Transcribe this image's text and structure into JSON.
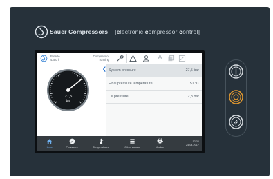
{
  "brand": {
    "name": "Sauer Compressors",
    "tagline_open": "[",
    "tagline_parts": [
      {
        "b": "e",
        "t": "lectronic "
      },
      {
        "b": "c",
        "t": "ompressor "
      },
      {
        "b": "c",
        "t": "ontrol"
      }
    ],
    "tagline_close": "]",
    "tagline": "[electronic compressor control]"
  },
  "status_bar": {
    "ship_line1": "Breeze",
    "ship_line2": "4350 h",
    "state_line1": "Compressor",
    "state_line2": "running",
    "icons": [
      "wrench-icon",
      "warning-icon",
      "user-icon",
      "a-icon",
      "layers-icon",
      "edit-icon"
    ],
    "a_glyph": "A"
  },
  "gauge": {
    "value": "27,5",
    "unit": "bar",
    "needle_value": 27.5
  },
  "measurements": [
    {
      "label": "System pressure",
      "value": "27,5 bar"
    },
    {
      "label": "Final pressure temperature",
      "value": "51 °C"
    },
    {
      "label": "Oil pressure",
      "value": "2,8 bar"
    }
  ],
  "nav": [
    {
      "label": "Home",
      "icon": "home-icon",
      "active": true
    },
    {
      "label": "Pressures",
      "icon": "gauge-icon",
      "active": false
    },
    {
      "label": "Temperatures",
      "icon": "thermometer-icon",
      "active": false
    },
    {
      "label": "Other values",
      "icon": "list-icon",
      "active": false
    },
    {
      "label": "Modes",
      "icon": "gear-icon",
      "active": false
    }
  ],
  "clock": {
    "time": "12:30",
    "date": "24.04.2017"
  },
  "side_buttons": [
    {
      "name": "power-on",
      "color": "#d8dde1"
    },
    {
      "name": "power-off",
      "color": "#e49a2f"
    },
    {
      "name": "reset",
      "color": "#d8dde1"
    }
  ],
  "colors": {
    "panel": "#26313a",
    "accent_orange": "#e49a2f",
    "active_blue": "#6fb1f0"
  }
}
